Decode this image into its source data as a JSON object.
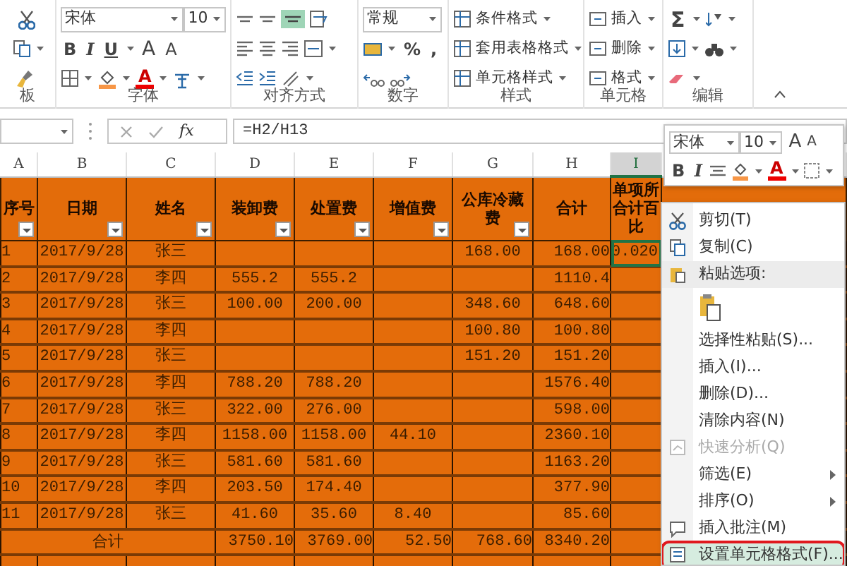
{
  "ribbon": {
    "clipboard": {
      "label": "板"
    },
    "font": {
      "label": "字体",
      "font_name": "宋体",
      "font_size": "10",
      "bold": "B",
      "italic": "I",
      "underline": "U",
      "grow": "A",
      "shrink": "A",
      "font_color": "A"
    },
    "alignment": {
      "label": "对齐方式"
    },
    "number": {
      "label": "数字",
      "format": "常规",
      "percent": "%",
      "comma": ","
    },
    "styles": {
      "label": "样式",
      "items": [
        "条件格式",
        "套用表格格式",
        "单元格样式"
      ]
    },
    "cells": {
      "label": "单元格",
      "items": [
        "插入",
        "删除",
        "格式"
      ]
    },
    "editing": {
      "label": "编辑",
      "sum": "Σ"
    }
  },
  "formula_bar": {
    "fx": "fx",
    "formula": "=H2/H13"
  },
  "sheet": {
    "columns": [
      {
        "letter": "A",
        "selected": false,
        "header": [
          "序号"
        ],
        "filter": true
      },
      {
        "letter": "B",
        "selected": false,
        "header": [
          "日期"
        ],
        "filter": true
      },
      {
        "letter": "C",
        "selected": false,
        "header": [
          "姓名"
        ],
        "filter": true
      },
      {
        "letter": "D",
        "selected": false,
        "header": [
          "装卸费"
        ],
        "filter": true
      },
      {
        "letter": "E",
        "selected": false,
        "header": [
          "处置费"
        ],
        "filter": true
      },
      {
        "letter": "F",
        "selected": false,
        "header": [
          "增值费"
        ],
        "filter": true
      },
      {
        "letter": "G",
        "selected": false,
        "header": [
          "公库冷藏",
          "费"
        ],
        "filter": true
      },
      {
        "letter": "H",
        "selected": false,
        "header": [
          "合计"
        ],
        "filter": false
      },
      {
        "letter": "I",
        "selected": true,
        "header": [
          "单项所",
          "合计百",
          "比"
        ],
        "filter": false
      }
    ],
    "rows": [
      {
        "cells": [
          {
            "text": "1",
            "selected": false
          },
          {
            "text": "2017/9/28",
            "selected": false
          },
          {
            "text": "张三",
            "selected": false
          },
          {
            "selected": false
          },
          {
            "selected": false
          },
          {
            "selected": false
          },
          {
            "text": "168.00",
            "selected": false
          },
          {
            "text": "168.00",
            "selected": false
          },
          {
            "text": "0.020",
            "selected": true
          }
        ]
      },
      {
        "cells": [
          {
            "text": "2",
            "selected": false
          },
          {
            "text": "2017/9/28",
            "selected": false
          },
          {
            "text": "李四",
            "selected": false
          },
          {
            "text": "555.2",
            "selected": false
          },
          {
            "text": "555.2",
            "selected": false
          },
          {
            "selected": false
          },
          {
            "selected": false
          },
          {
            "text": "1110.4",
            "selected": false
          },
          {
            "selected": false
          }
        ]
      },
      {
        "cells": [
          {
            "text": "3",
            "selected": false
          },
          {
            "text": "2017/9/28",
            "selected": false
          },
          {
            "text": "张三",
            "selected": false
          },
          {
            "text": "100.00",
            "selected": false
          },
          {
            "text": "200.00",
            "selected": false
          },
          {
            "selected": false
          },
          {
            "text": "348.60",
            "selected": false
          },
          {
            "text": "648.60",
            "selected": false
          },
          {
            "selected": false
          }
        ]
      },
      {
        "cells": [
          {
            "text": "4",
            "selected": false
          },
          {
            "text": "2017/9/28",
            "selected": false
          },
          {
            "text": "李四",
            "selected": false
          },
          {
            "selected": false
          },
          {
            "selected": false
          },
          {
            "selected": false
          },
          {
            "text": "100.80",
            "selected": false
          },
          {
            "text": "100.80",
            "selected": false
          },
          {
            "selected": false
          }
        ]
      },
      {
        "cells": [
          {
            "text": "5",
            "selected": false
          },
          {
            "text": "2017/9/28",
            "selected": false
          },
          {
            "text": "张三",
            "selected": false
          },
          {
            "selected": false
          },
          {
            "selected": false
          },
          {
            "selected": false
          },
          {
            "text": "151.20",
            "selected": false
          },
          {
            "text": "151.20",
            "selected": false
          },
          {
            "selected": false
          }
        ]
      },
      {
        "cells": [
          {
            "text": "6",
            "selected": false
          },
          {
            "text": "2017/9/28",
            "selected": false
          },
          {
            "text": "李四",
            "selected": false
          },
          {
            "text": "788.20",
            "selected": false
          },
          {
            "text": "788.20",
            "selected": false
          },
          {
            "selected": false
          },
          {
            "selected": false
          },
          {
            "text": "1576.40",
            "selected": false
          },
          {
            "selected": false
          }
        ]
      },
      {
        "cells": [
          {
            "text": "7",
            "selected": false
          },
          {
            "text": "2017/9/28",
            "selected": false
          },
          {
            "text": "张三",
            "selected": false
          },
          {
            "text": "322.00",
            "selected": false
          },
          {
            "text": "276.00",
            "selected": false
          },
          {
            "selected": false
          },
          {
            "selected": false
          },
          {
            "text": "598.00",
            "selected": false
          },
          {
            "selected": false
          }
        ]
      },
      {
        "cells": [
          {
            "text": "8",
            "selected": false
          },
          {
            "text": "2017/9/28",
            "selected": false
          },
          {
            "text": "李四",
            "selected": false
          },
          {
            "text": "1158.00",
            "selected": false
          },
          {
            "text": "1158.00",
            "selected": false
          },
          {
            "text": "44.10",
            "selected": false
          },
          {
            "selected": false
          },
          {
            "text": "2360.10",
            "selected": false
          },
          {
            "selected": false
          }
        ]
      },
      {
        "cells": [
          {
            "text": "9",
            "selected": false
          },
          {
            "text": "2017/9/28",
            "selected": false
          },
          {
            "text": "张三",
            "selected": false
          },
          {
            "text": "581.60",
            "selected": false
          },
          {
            "text": "581.60",
            "selected": false
          },
          {
            "selected": false
          },
          {
            "selected": false
          },
          {
            "text": "1163.20",
            "selected": false
          },
          {
            "selected": false
          }
        ]
      },
      {
        "cells": [
          {
            "text": "10",
            "selected": false
          },
          {
            "text": "2017/9/28",
            "selected": false
          },
          {
            "text": "李四",
            "selected": false
          },
          {
            "text": "203.50",
            "selected": false
          },
          {
            "text": "174.40",
            "selected": false
          },
          {
            "selected": false
          },
          {
            "selected": false
          },
          {
            "text": "377.90",
            "selected": false
          },
          {
            "selected": false
          }
        ]
      },
      {
        "cells": [
          {
            "text": "11",
            "selected": false
          },
          {
            "text": "2017/9/28",
            "selected": false
          },
          {
            "text": "张三",
            "selected": false
          },
          {
            "text": "41.60",
            "selected": false
          },
          {
            "text": "35.60",
            "selected": false
          },
          {
            "text": "8.40",
            "selected": false
          },
          {
            "selected": false
          },
          {
            "text": "85.60",
            "selected": false
          },
          {
            "selected": false
          }
        ]
      }
    ],
    "total": {
      "label": "合计",
      "values": [
        "3750.10",
        "3769.00",
        "52.50",
        "768.60",
        "8340.20"
      ]
    }
  },
  "mini_toolbar": {
    "font_name": "宋体",
    "font_size": "10",
    "grow": "A",
    "shrink": "A",
    "bold": "B",
    "italic": "I",
    "font_color": "A"
  },
  "context_menu": {
    "items": [
      {
        "kind": "item",
        "label": "剪切(T)",
        "disabled": false,
        "submenu": false,
        "selected": false,
        "annotated": false
      },
      {
        "kind": "item",
        "label": "复制(C)",
        "disabled": false,
        "submenu": false,
        "selected": false,
        "annotated": false
      },
      {
        "kind": "header",
        "label": "粘贴选项:"
      },
      {
        "kind": "paste_option"
      },
      {
        "kind": "item",
        "label": "选择性粘贴(S)...",
        "disabled": false,
        "submenu": false,
        "selected": false,
        "annotated": false
      },
      {
        "kind": "item",
        "label": "插入(I)...",
        "disabled": false,
        "submenu": false,
        "selected": false,
        "annotated": false
      },
      {
        "kind": "item",
        "label": "删除(D)...",
        "disabled": false,
        "submenu": false,
        "selected": false,
        "annotated": false
      },
      {
        "kind": "item",
        "label": "清除内容(N)",
        "disabled": false,
        "submenu": false,
        "selected": false,
        "annotated": false
      },
      {
        "kind": "item",
        "label": "快速分析(Q)",
        "disabled": true,
        "submenu": false,
        "selected": false,
        "annotated": false
      },
      {
        "kind": "item",
        "label": "筛选(E)",
        "disabled": false,
        "submenu": true,
        "selected": false,
        "annotated": false
      },
      {
        "kind": "item",
        "label": "排序(O)",
        "disabled": false,
        "submenu": true,
        "selected": false,
        "annotated": false
      },
      {
        "kind": "item",
        "label": "插入批注(M)",
        "disabled": false,
        "submenu": false,
        "selected": false,
        "annotated": false
      },
      {
        "kind": "item",
        "label": "设置单元格格式(F)...",
        "disabled": false,
        "submenu": false,
        "selected": true,
        "annotated": true
      }
    ]
  }
}
